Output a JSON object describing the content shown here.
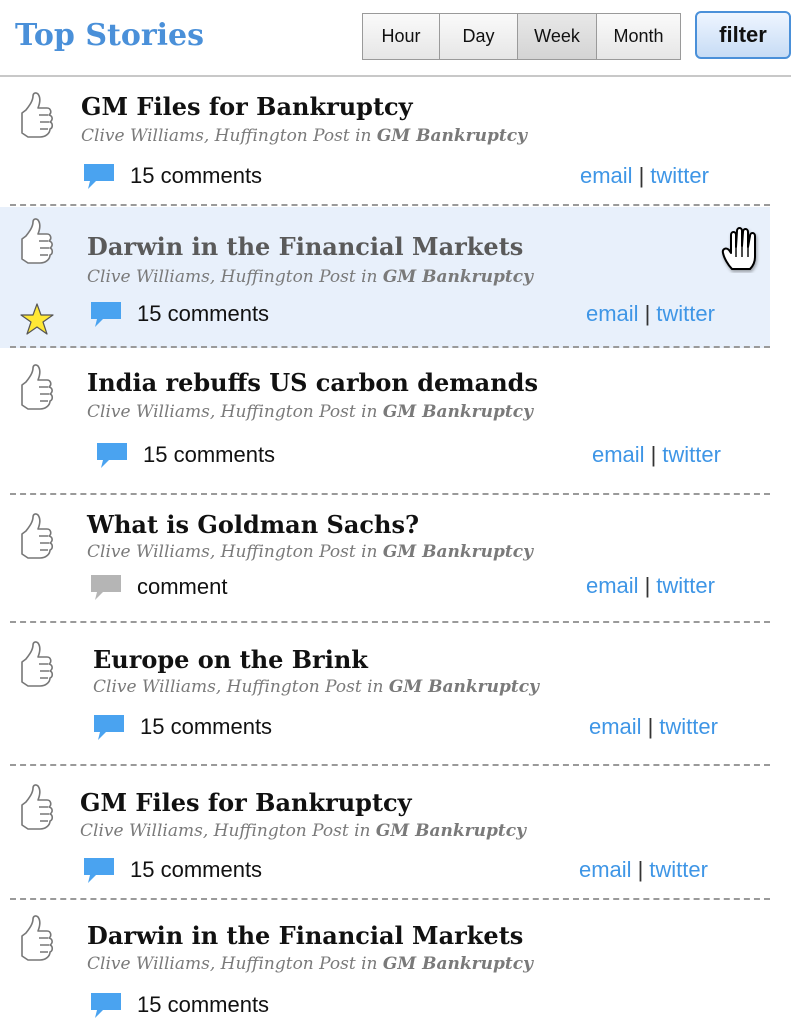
{
  "header": {
    "title": "Top Stories",
    "time_filters": [
      {
        "label": "Hour",
        "active": false
      },
      {
        "label": "Day",
        "active": false
      },
      {
        "label": "Week",
        "active": true
      },
      {
        "label": "Month",
        "active": false
      }
    ],
    "filter_label": "filter"
  },
  "colors": {
    "title_blue": "#4a90d9",
    "link_blue": "#3f96e6",
    "bubble_blue": "#4aa3f0",
    "bubble_gray": "#b5b5b5",
    "highlight_bg": "#e8f0fb",
    "star_yellow": "#ffe835"
  },
  "stories": [
    {
      "title": "GM Files for Bankruptcy",
      "byline": "Clive Williams, Huffington Post in",
      "topic": "GM Bankruptcy",
      "comments": "15 comments",
      "comment_icon": "comment-bubble-blue-icon",
      "email": "email",
      "sep": "|",
      "twitter": "twitter",
      "starred": false,
      "highlighted": false
    },
    {
      "title": "Darwin in the Financial Markets",
      "byline": "Clive Williams, Huffington Post in",
      "topic": "GM Bankruptcy",
      "comments": "15 comments",
      "comment_icon": "comment-bubble-blue-icon",
      "email": "email",
      "sep": "|",
      "twitter": "twitter",
      "starred": true,
      "highlighted": true
    },
    {
      "title": "India rebuffs US carbon demands",
      "byline": "Clive Williams, Huffington Post in",
      "topic": "GM Bankruptcy",
      "comments": "15 comments",
      "comment_icon": "comment-bubble-blue-icon",
      "email": "email",
      "sep": "|",
      "twitter": "twitter",
      "starred": false,
      "highlighted": false
    },
    {
      "title": "What is Goldman Sachs?",
      "byline": "Clive Williams, Huffington Post in",
      "topic": "GM Bankruptcy",
      "comments": "comment",
      "comment_icon": "comment-bubble-gray-icon",
      "email": "email",
      "sep": "|",
      "twitter": "twitter",
      "starred": false,
      "highlighted": false
    },
    {
      "title": "Europe on the Brink",
      "byline": "Clive Williams, Huffington Post in",
      "topic": "GM Bankruptcy",
      "comments": "15 comments",
      "comment_icon": "comment-bubble-blue-icon",
      "email": "email",
      "sep": "|",
      "twitter": "twitter",
      "starred": false,
      "highlighted": false
    },
    {
      "title": "GM Files for Bankruptcy",
      "byline": "Clive Williams, Huffington Post in",
      "topic": "GM Bankruptcy",
      "comments": "15 comments",
      "comment_icon": "comment-bubble-blue-icon",
      "email": "email",
      "sep": "|",
      "twitter": "twitter",
      "starred": false,
      "highlighted": false
    },
    {
      "title": "Darwin in the Financial Markets",
      "byline": "Clive Williams, Huffington Post in",
      "topic": "GM Bankruptcy",
      "comments": "15 comments",
      "comment_icon": "comment-bubble-blue-icon",
      "starred": false,
      "highlighted": false
    }
  ],
  "icons": {
    "thumb": "thumbs-up-icon",
    "star": "star-icon",
    "cursor": "hand-cursor-icon"
  }
}
